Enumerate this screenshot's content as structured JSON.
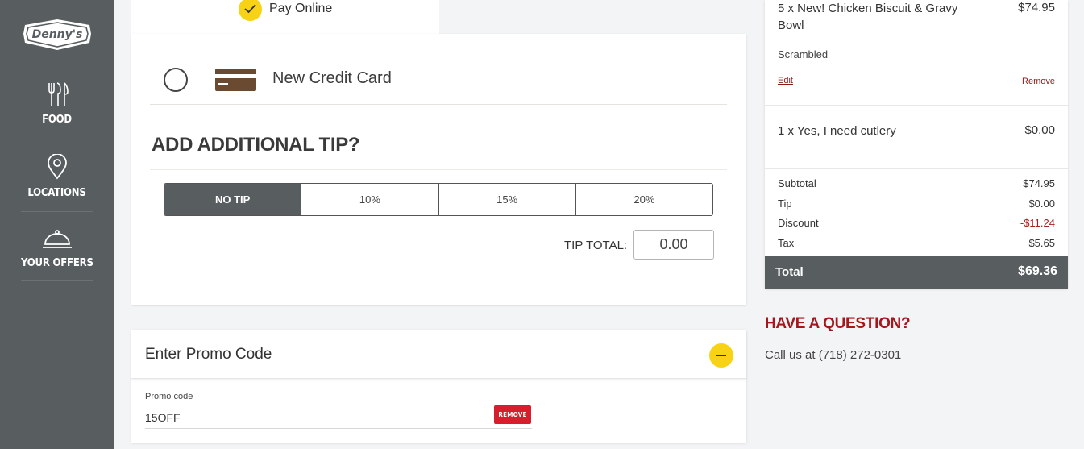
{
  "brand": {
    "logo_text": "Denny's"
  },
  "sidebar": {
    "items": [
      {
        "label": "FOOD",
        "icon": "utensils-icon"
      },
      {
        "label": "LOCATIONS",
        "icon": "map-pin-icon"
      },
      {
        "label": "YOUR OFFERS",
        "icon": "cloche-icon"
      }
    ]
  },
  "payment": {
    "tab_label": "Pay Online",
    "method_label": "New Credit Card"
  },
  "tip": {
    "heading": "ADD ADDITIONAL TIP?",
    "options": [
      "NO TIP",
      "10%",
      "15%",
      "20%"
    ],
    "selected": "NO TIP",
    "total_label": "TIP TOTAL:",
    "total_value": "0.00"
  },
  "promo": {
    "title": "Enter Promo Code",
    "field_label": "Promo code",
    "field_value": "15OFF",
    "remove_label": "REMOVE"
  },
  "order": {
    "items": [
      {
        "name": "5 x New! Chicken Biscuit & Gravy Bowl",
        "price": "$74.95",
        "option": "Scrambled",
        "edit_label": "Edit",
        "remove_label": "Remove"
      },
      {
        "name": "1 x Yes, I need cutlery",
        "price": "$0.00"
      }
    ],
    "subtotal_label": "Subtotal",
    "subtotal": "$74.95",
    "tip_label": "Tip",
    "tip": "$0.00",
    "discount_label": "Discount",
    "discount": "-$11.24",
    "tax_label": "Tax",
    "tax": "$5.65",
    "total_label": "Total",
    "total": "$69.36"
  },
  "help": {
    "question": "HAVE A QUESTION?",
    "call_text": "Call us at (718) 272-0301"
  },
  "colors": {
    "sidebar": "#585d60",
    "accent_yellow": "#f7d215",
    "brand_red": "#a4171b",
    "remove_red": "#d81e2c"
  }
}
